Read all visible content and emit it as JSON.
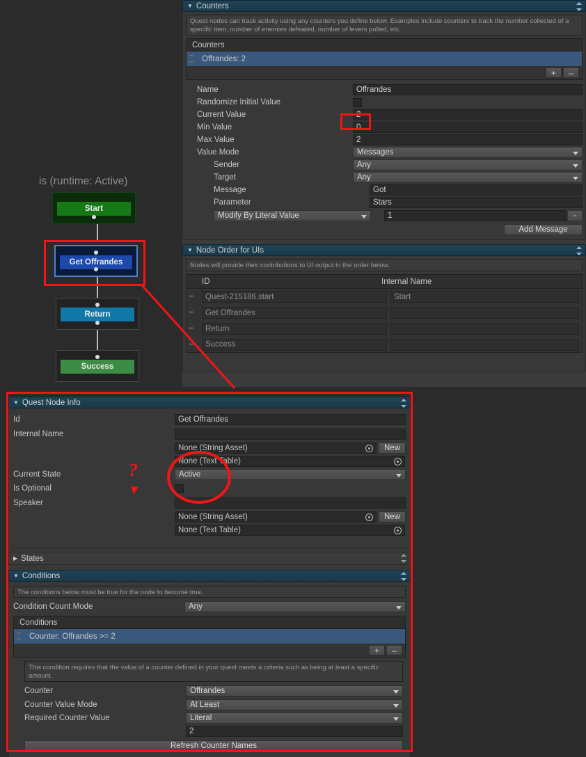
{
  "graph": {
    "title": "is (runtime: Active)",
    "nodes": [
      {
        "id": "start",
        "label": "Start"
      },
      {
        "id": "get",
        "label": "Get Offrandes"
      },
      {
        "id": "return",
        "label": "Return"
      },
      {
        "id": "success",
        "label": "Success"
      }
    ]
  },
  "counters_section": {
    "title": "Counters",
    "help": "Quest nodes can track activity using any counters you define below. Examples include counters to track the number collected of a specific item, number of enemies defeated, number of levers pulled, etc.",
    "list_header": "Counters",
    "list_items": [
      "Offrandes: 2"
    ],
    "add_label": "+",
    "remove_label": "–",
    "fields": {
      "name_label": "Name",
      "name_value": "Offrandes",
      "randomize_label": "Randomize Initial Value",
      "randomize_checked": false,
      "current_label": "Current Value",
      "current_value": "2",
      "min_label": "Min Value",
      "min_value": "0",
      "max_label": "Max Value",
      "max_value": "2",
      "value_mode_label": "Value Mode",
      "value_mode_value": "Messages",
      "sender_label": "Sender",
      "sender_value": "Any",
      "target_label": "Target",
      "target_value": "Any",
      "message_label": "Message",
      "message_value": "Got",
      "parameter_label": "Parameter",
      "parameter_value": "Stars",
      "modify_mode_value": "Modify By Literal Value",
      "modify_amount": "1",
      "modify_remove_label": "-",
      "add_message_label": "Add Message"
    }
  },
  "node_order_section": {
    "title": "Node Order for UIs",
    "help": "Nodes will provide their contributions to UI output in the order below.",
    "columns": [
      "ID",
      "Internal Name"
    ],
    "rows": [
      {
        "id": "Quest-215186.start",
        "internal_name": "Start"
      },
      {
        "id": "Get Offrandes",
        "internal_name": ""
      },
      {
        "id": "Return",
        "internal_name": ""
      },
      {
        "id": "Success",
        "internal_name": ""
      }
    ]
  },
  "quest_node_info": {
    "title": "Quest Node Info",
    "id_label": "Id",
    "id_value": "Get Offrandes",
    "internal_name_label": "Internal Name",
    "internal_name_value": "",
    "string_asset_1": "None (String Asset)",
    "new_label_1": "New",
    "text_table_1": "None (Text Table)",
    "current_state_label": "Current State",
    "current_state_value": "Active",
    "is_optional_label": "Is Optional",
    "is_optional_checked": false,
    "speaker_label": "Speaker",
    "speaker_value": "",
    "string_asset_2": "None (String Asset)",
    "new_label_2": "New",
    "text_table_2": "None (Text Table)"
  },
  "states_section": {
    "title": "States"
  },
  "conditions_section": {
    "title": "Conditions",
    "help": "The conditions below must be true for the node to become true.",
    "count_mode_label": "Condition Count Mode",
    "count_mode_value": "Any",
    "list_header": "Conditions",
    "list_items": [
      "Counter: Offrandes >= 2"
    ],
    "add_label": "+",
    "remove_label": "–",
    "detail_help": "This condition requires that the value of a counter defined in your quest meets a criteria such as being at least a specific amount.",
    "counter_label": "Counter",
    "counter_value": "Offrandes",
    "counter_value_mode_label": "Counter Value Mode",
    "counter_value_mode_value": "At Least",
    "required_counter_value_label": "Required Counter Value",
    "required_counter_value_mode": "Literal",
    "required_counter_value": "2",
    "refresh_label": "Refresh Counter Names"
  },
  "annotation": {
    "color": "#f41414",
    "question_mark": "?"
  }
}
